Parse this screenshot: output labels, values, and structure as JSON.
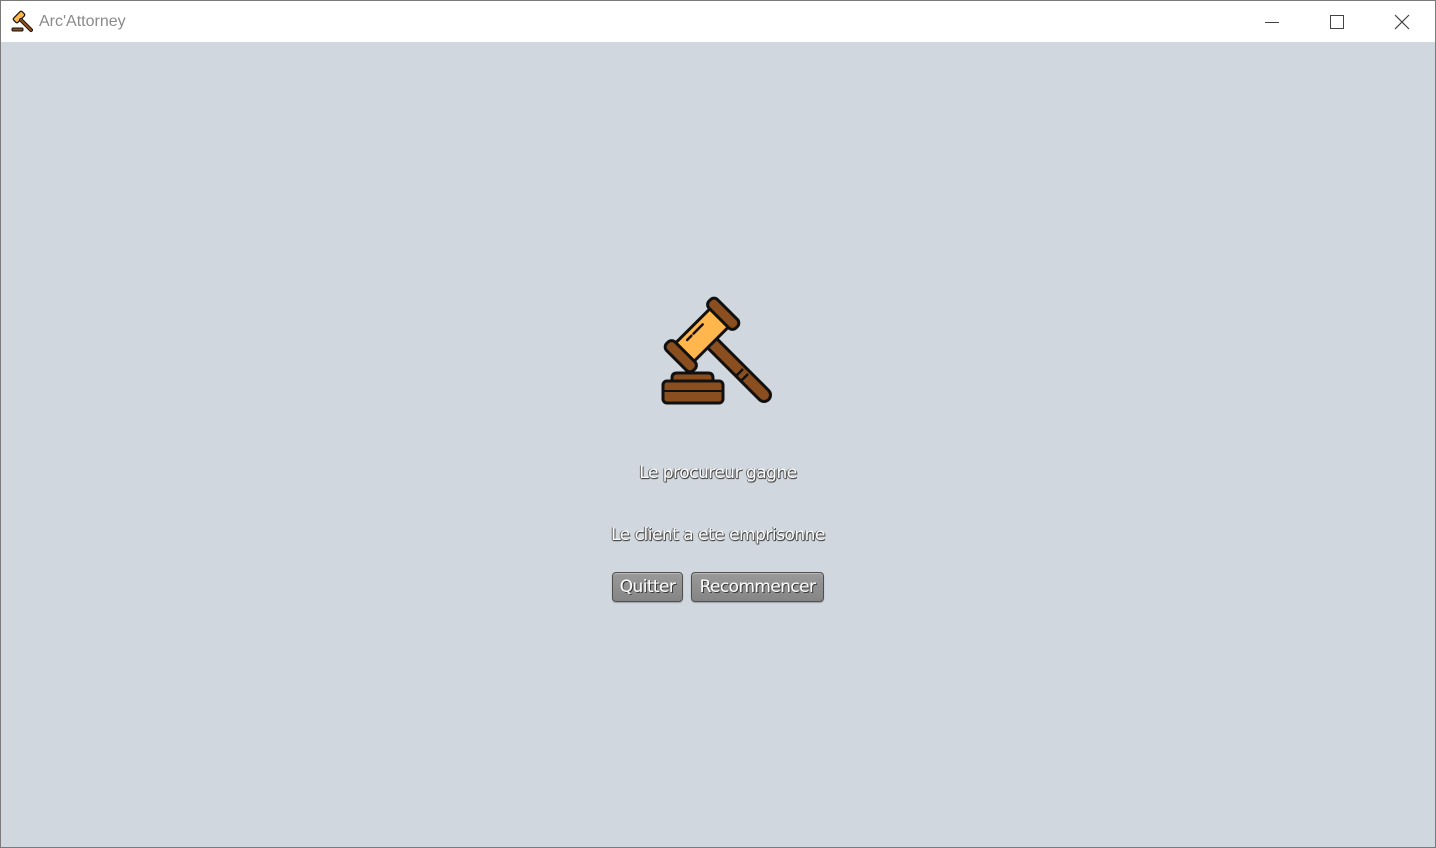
{
  "window": {
    "title": "Arc'Attorney",
    "controls": {
      "minimize_icon": "minimize-icon",
      "maximize_icon": "maximize-icon",
      "close_icon": "close-icon"
    }
  },
  "main": {
    "result_text": "Le procureur gagne",
    "verdict_text": "Le client a ete emprisonne",
    "buttons": {
      "quit_label": "Quitter",
      "restart_label": "Recommencer"
    },
    "icon": "gavel-icon"
  },
  "colors": {
    "background": "#d0d7de",
    "titlebar": "#ffffff",
    "button": "#8e8e8e",
    "gavel_head": "#ffb74d",
    "gavel_wood": "#8b4e1e"
  }
}
